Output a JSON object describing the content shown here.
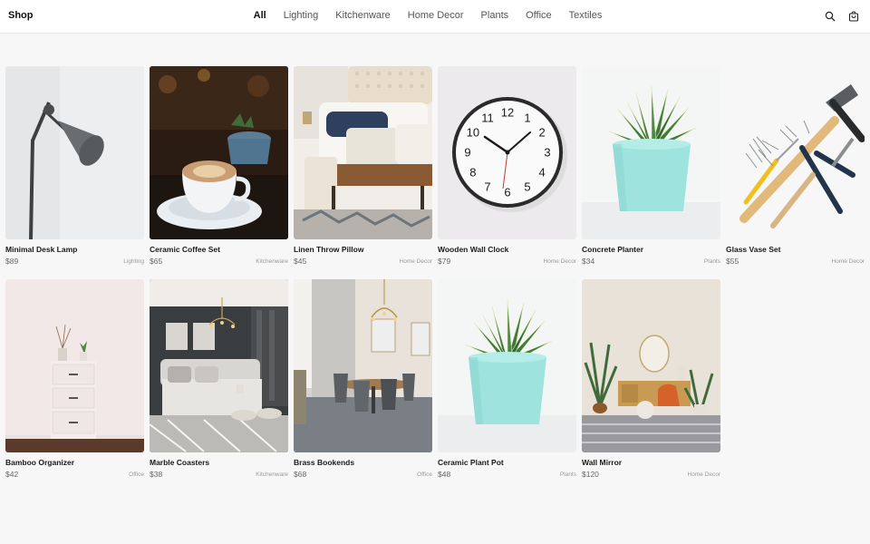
{
  "header": {
    "brand": "Shop",
    "nav": [
      {
        "label": "All",
        "active": true
      },
      {
        "label": "Lighting",
        "active": false
      },
      {
        "label": "Kitchenware",
        "active": false
      },
      {
        "label": "Home Decor",
        "active": false
      },
      {
        "label": "Plants",
        "active": false
      },
      {
        "label": "Office",
        "active": false
      },
      {
        "label": "Textiles",
        "active": false
      }
    ],
    "icons": [
      "search-icon",
      "shopping-bag-icon"
    ]
  },
  "products": [
    {
      "name": "Minimal Desk Lamp",
      "price": "$89",
      "category": "Lighting",
      "image": "desk-lamp"
    },
    {
      "name": "Ceramic Coffee Set",
      "price": "$65",
      "category": "Kitchenware",
      "image": "coffee-cup"
    },
    {
      "name": "Linen Throw Pillow",
      "price": "$45",
      "category": "Home Decor",
      "image": "bedroom-pillows"
    },
    {
      "name": "Wooden Wall Clock",
      "price": "$79",
      "category": "Home Decor",
      "image": "wall-clock"
    },
    {
      "name": "Concrete Planter",
      "price": "$34",
      "category": "Plants",
      "image": "potted-succulent"
    },
    {
      "name": "Glass Vase Set",
      "price": "$55",
      "category": "Home Decor",
      "image": "hand-tools"
    },
    {
      "name": "Bamboo Organizer",
      "price": "$42",
      "category": "Office",
      "image": "drawer-cabinet"
    },
    {
      "name": "Marble Coasters",
      "price": "$38",
      "category": "Kitchenware",
      "image": "bedroom-interior"
    },
    {
      "name": "Brass Bookends",
      "price": "$68",
      "category": "Office",
      "image": "dining-room"
    },
    {
      "name": "Ceramic Plant Pot",
      "price": "$48",
      "category": "Plants",
      "image": "potted-succulent"
    },
    {
      "name": "Wall Mirror",
      "price": "$120",
      "category": "Home Decor",
      "image": "living-room"
    }
  ],
  "clock": {
    "numerals": [
      "12",
      "1",
      "2",
      "3",
      "4",
      "5",
      "6",
      "7",
      "8",
      "9",
      "10",
      "11"
    ]
  }
}
